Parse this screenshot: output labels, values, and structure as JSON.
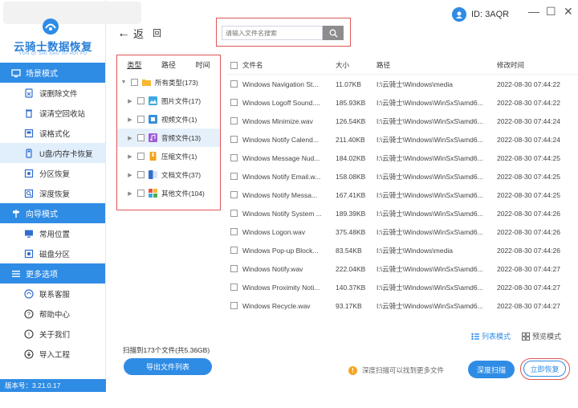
{
  "brand": {
    "name": "云骑士数据恢复",
    "subtitle": "YUN QI SHI SHU JU HUI FU"
  },
  "sidebar": {
    "sections": [
      {
        "title": "场景模式",
        "icon": "monitor-icon",
        "items": [
          {
            "label": "误删除文件",
            "icon": "delete-file-icon"
          },
          {
            "label": "误清空回收站",
            "icon": "recycle-bin-icon"
          },
          {
            "label": "误格式化",
            "icon": "format-icon"
          },
          {
            "label": "U盘/内存卡恢复",
            "icon": "usb-card-icon",
            "active": true
          },
          {
            "label": "分区恢复",
            "icon": "partition-icon"
          },
          {
            "label": "深度恢复",
            "icon": "deep-recover-icon"
          }
        ]
      },
      {
        "title": "向导模式",
        "icon": "signpost-icon",
        "items": [
          {
            "label": "常用位置",
            "icon": "desktop-icon"
          },
          {
            "label": "磁盘分区",
            "icon": "disk-partition-icon"
          }
        ]
      },
      {
        "title": "更多选项",
        "icon": "menu-icon",
        "items": [
          {
            "label": "联系客服",
            "icon": "headset-icon"
          },
          {
            "label": "帮助中心",
            "icon": "help-icon"
          },
          {
            "label": "关于我们",
            "icon": "info-icon"
          },
          {
            "label": "导入工程",
            "icon": "import-icon"
          }
        ]
      }
    ],
    "version": "版本号：3.21.0.17"
  },
  "topbar": {
    "back_label": "返",
    "home_label": "回",
    "search_placeholder": "请输入文件名搜索",
    "user_id": "ID: 3AQR",
    "minimize": "—",
    "maximize": "☐",
    "close": "✕"
  },
  "tree": {
    "tabs": [
      "类型",
      "路径",
      "时间"
    ],
    "active_tab": "类型",
    "rows": [
      {
        "label": "所有类型(173)",
        "level": 0,
        "expanded": true,
        "color": "#f7b731"
      },
      {
        "label": "图片文件(17)",
        "level": 1,
        "color": "#3fa9e0"
      },
      {
        "label": "视频文件(1)",
        "level": 1,
        "color": "#3a8fd8"
      },
      {
        "label": "音频文件(13)",
        "level": 1,
        "color": "#a05bd6",
        "highlighted": true
      },
      {
        "label": "压缩文件(1)",
        "level": 1,
        "color": "#f2a31b"
      },
      {
        "label": "文档文件(37)",
        "level": 1,
        "color": "#2f6ecf"
      },
      {
        "label": "其他文件(104)",
        "level": 1,
        "color": "#e8553a"
      }
    ]
  },
  "table": {
    "headers": {
      "name": "文件名",
      "size": "大小",
      "path": "路径",
      "time": "修改时间"
    },
    "rows": [
      {
        "name": "Windows Navigation St...",
        "size": "11.07KB",
        "path": "I:\\云骑士\\Windows\\media",
        "time": "2022-08-30 07:44:22"
      },
      {
        "name": "Windows Logoff Sound....",
        "size": "185.93KB",
        "path": "I:\\云骑士\\Windows\\WinSxS\\amd6...",
        "time": "2022-08-30 07:44:22"
      },
      {
        "name": "Windows Minimize.wav",
        "size": "126.54KB",
        "path": "I:\\云骑士\\Windows\\WinSxS\\amd6...",
        "time": "2022-08-30 07:44:24"
      },
      {
        "name": "Windows Notify Calend...",
        "size": "211.40KB",
        "path": "I:\\云骑士\\Windows\\WinSxS\\amd6...",
        "time": "2022-08-30 07:44:24"
      },
      {
        "name": "Windows Message Nud...",
        "size": "184.02KB",
        "path": "I:\\云骑士\\Windows\\WinSxS\\amd6...",
        "time": "2022-08-30 07:44:25"
      },
      {
        "name": "Windows Notify Email.w...",
        "size": "158.08KB",
        "path": "I:\\云骑士\\Windows\\WinSxS\\amd6...",
        "time": "2022-08-30 07:44:25"
      },
      {
        "name": "Windows Notify Messa...",
        "size": "167.41KB",
        "path": "I:\\云骑士\\Windows\\WinSxS\\amd6...",
        "time": "2022-08-30 07:44:25"
      },
      {
        "name": "Windows Notify System ...",
        "size": "189.39KB",
        "path": "I:\\云骑士\\Windows\\WinSxS\\amd6...",
        "time": "2022-08-30 07:44:26"
      },
      {
        "name": "Windows Logon.wav",
        "size": "375.48KB",
        "path": "I:\\云骑士\\Windows\\WinSxS\\amd6...",
        "time": "2022-08-30 07:44:26"
      },
      {
        "name": "Windows Pop-up Block...",
        "size": "83.54KB",
        "path": "I:\\云骑士\\Windows\\media",
        "time": "2022-08-30 07:44:26"
      },
      {
        "name": "Windows Notify.wav",
        "size": "222.04KB",
        "path": "I:\\云骑士\\Windows\\WinSxS\\amd6...",
        "time": "2022-08-30 07:44:27"
      },
      {
        "name": "Windows Proximity Noti...",
        "size": "140.37KB",
        "path": "I:\\云骑士\\Windows\\WinSxS\\amd6...",
        "time": "2022-08-30 07:44:27"
      },
      {
        "name": "Windows Recycle.wav",
        "size": "93.17KB",
        "path": "I:\\云骑士\\Windows\\WinSxS\\amd6...",
        "time": "2022-08-30 07:44:27"
      }
    ]
  },
  "bottom": {
    "list_mode": "列表模式",
    "preview_mode": "预览模式",
    "scan_summary": "扫描到173个文件(共5.36GB)",
    "export_label": "导出文件列表",
    "hint": "深度扫描可以找到更多文件",
    "deep_scan_label": "深度扫描",
    "recover_label": "立即恢复"
  },
  "colors": {
    "accent": "#2f8ce5",
    "highlight_box": "#e05555",
    "active_bg": "#e1eefc"
  }
}
